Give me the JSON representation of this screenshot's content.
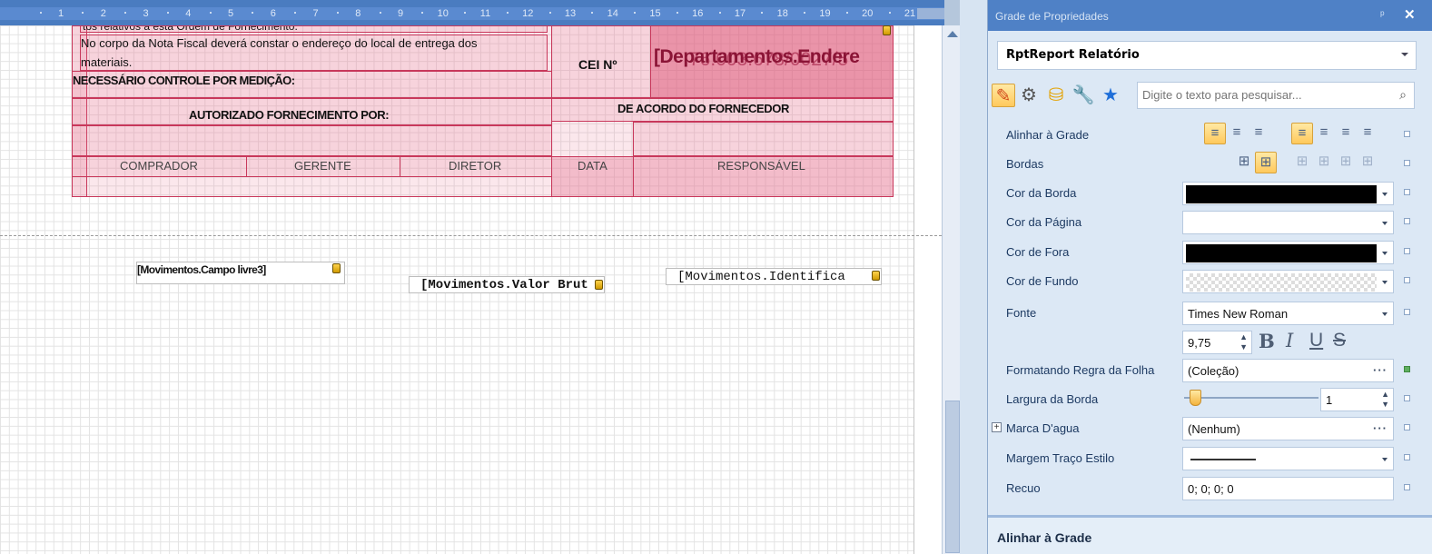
{
  "ruler": {
    "ticks": [
      "1",
      "2",
      "3",
      "4",
      "5",
      "6",
      "7",
      "8",
      "9",
      "10",
      "11",
      "12",
      "13",
      "14",
      "15",
      "16",
      "17",
      "18",
      "19",
      "20",
      "21"
    ]
  },
  "report": {
    "top_cut_text": "tos relativos a esta Ordem de Fornecimento.",
    "body_line1": "No corpo da Nota Fiscal deverá constar o endereço do local de entrega dos",
    "body_line2": "materiais.",
    "cei": "CEI Nº",
    "dept": "[Departamentos.Endere",
    "dept_overlap": "76.003.678/0027/5",
    "controle": "NECESSÁRIO CONTROLE POR MEDIÇÃO:",
    "autorizado": "AUTORIZADO FORNECIMENTO POR:",
    "acordo": "DE ACORDO DO FORNECEDOR",
    "signatures": [
      "COMPRADOR",
      "GERENTE",
      "DIRETOR",
      "DATA",
      "RESPONSÁVEL"
    ],
    "fields": [
      "[Movimentos.Campo livre3]",
      "[Movimentos.Valor Brut",
      "[Movimentos.Identifica"
    ]
  },
  "panel": {
    "title": "Grade de Propriedades",
    "pin": "ᵖ",
    "close": "✕",
    "selected_object": "RptReport  Relatório",
    "search_placeholder": "Digite o texto para pesquisar...",
    "properties": {
      "alinhar": "Alinhar à Grade",
      "bordas": "Bordas",
      "cor_borda": "Cor da Borda",
      "cor_pagina": "Cor da Página",
      "cor_fora": "Cor de Fora",
      "cor_fundo": "Cor de Fundo",
      "fonte": "Fonte",
      "fonte_value": "Times New Roman",
      "font_size": "9,75",
      "regra": "Formatando Regra da Folha",
      "regra_value": "(Coleção)",
      "largura": "Largura da Borda",
      "largura_value": "1",
      "marca": "Marca D'agua",
      "marca_value": "(Nenhum)",
      "margem": "Margem Traço Estilo",
      "recuo": "Recuo",
      "recuo_value": "0; 0; 0; 0"
    },
    "footer": "Alinhar à Grade"
  },
  "colors": {
    "border_color": "#000000",
    "outside_color": "#000000",
    "accent": "#4f81c6"
  }
}
